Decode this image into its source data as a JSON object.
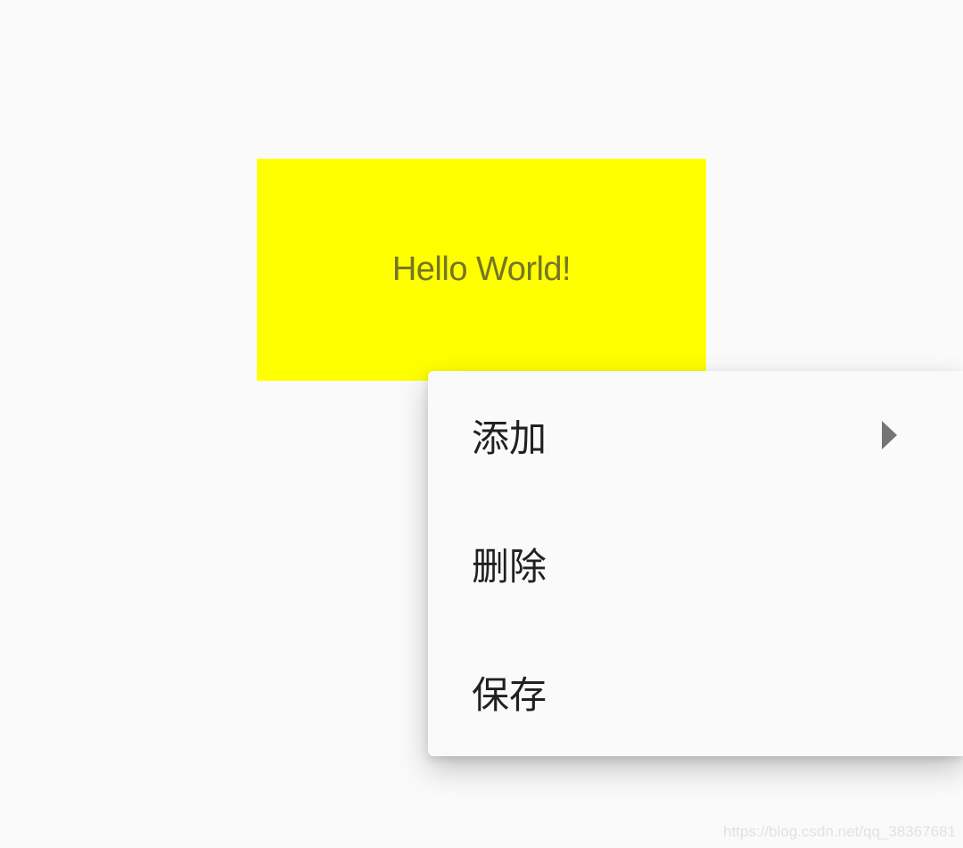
{
  "hello": {
    "text": "Hello World!",
    "background_color": "#ffff00"
  },
  "popup_menu": {
    "items": [
      {
        "label": "添加",
        "has_submenu": true,
        "submenu_icon": "triangle-right-icon"
      },
      {
        "label": "删除",
        "has_submenu": false
      },
      {
        "label": "保存",
        "has_submenu": false
      }
    ]
  },
  "watermark": {
    "text": "https://blog.csdn.net/qq_38367681"
  }
}
